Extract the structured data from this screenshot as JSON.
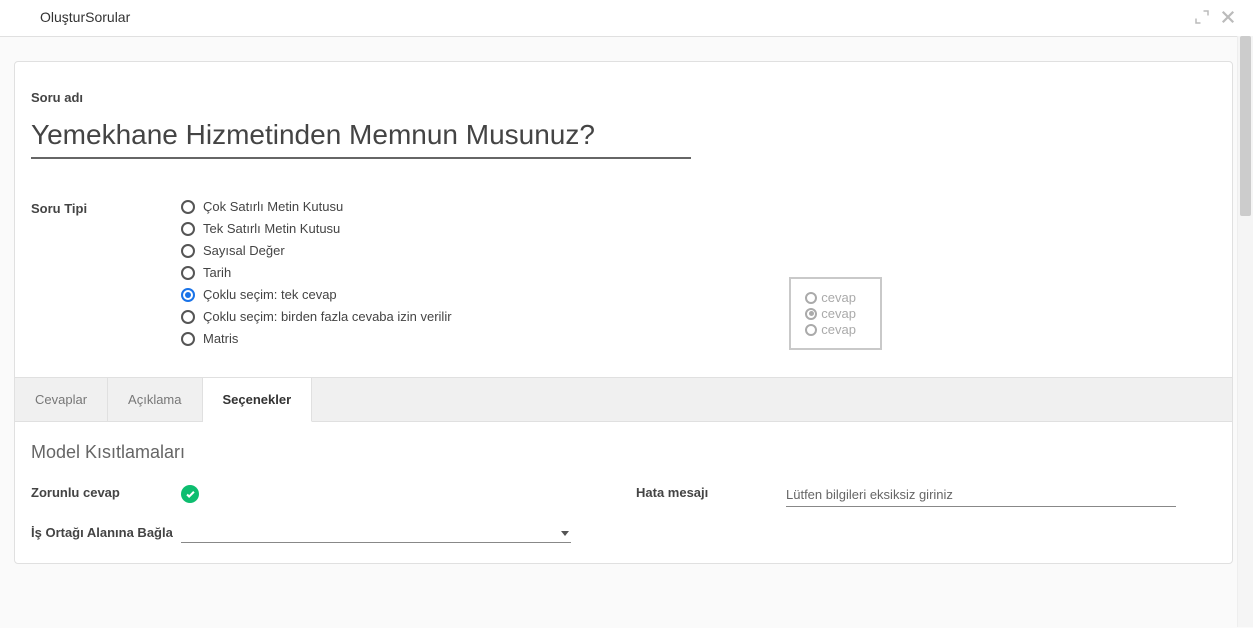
{
  "header": {
    "title": "OluşturSorular"
  },
  "form": {
    "questionNameLabel": "Soru adı",
    "questionName": "Yemekhane Hizmetinden Memnun Musunuz?",
    "questionTypeLabel": "Soru Tipi",
    "types": [
      {
        "label": "Çok Satırlı Metin Kutusu",
        "selected": false
      },
      {
        "label": "Tek Satırlı Metin Kutusu",
        "selected": false
      },
      {
        "label": "Sayısal Değer",
        "selected": false
      },
      {
        "label": "Tarih",
        "selected": false
      },
      {
        "label": "Çoklu seçim: tek cevap",
        "selected": true
      },
      {
        "label": "Çoklu seçim: birden fazla cevaba izin verilir",
        "selected": false
      },
      {
        "label": "Matris",
        "selected": false
      }
    ]
  },
  "preview": {
    "item": "cevap"
  },
  "tabs": [
    {
      "label": "Cevaplar",
      "active": false
    },
    {
      "label": "Açıklama",
      "active": false
    },
    {
      "label": "Seçenekler",
      "active": true
    }
  ],
  "options": {
    "sectionTitle": "Model Kısıtlamaları",
    "mandatoryLabel": "Zorunlu cevap",
    "errorMsgLabel": "Hata mesajı",
    "errorMsgValue": "Lütfen bilgileri eksiksiz giriniz",
    "bindPartnerLabel": "İş Ortağı Alanına Bağla"
  }
}
